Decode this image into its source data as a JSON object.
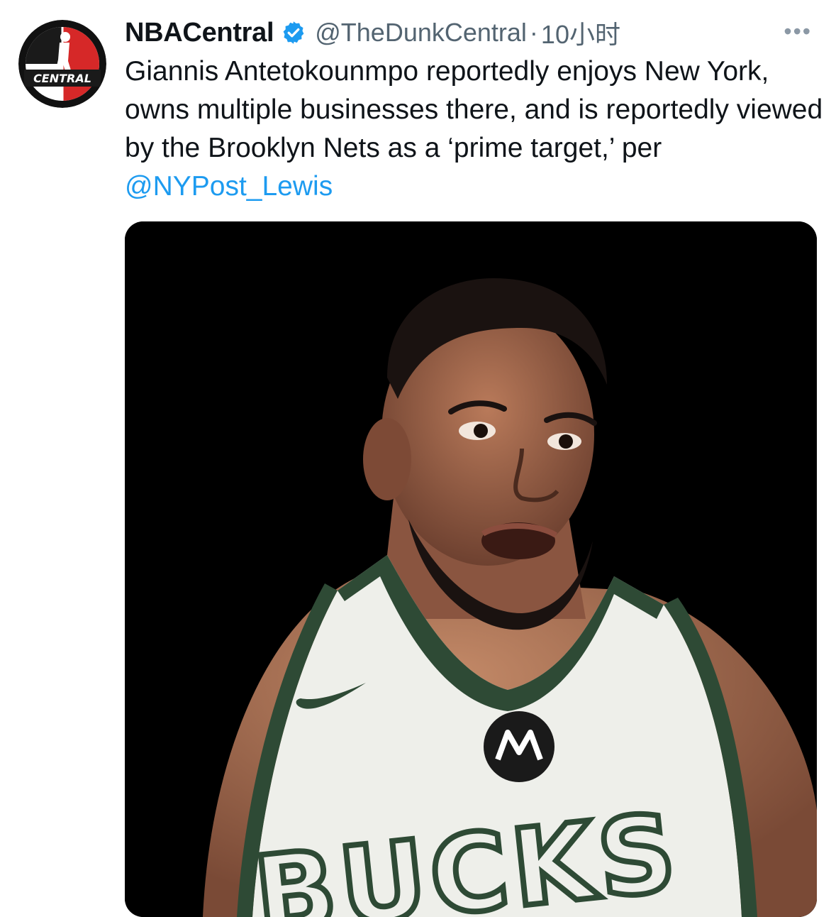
{
  "tweet": {
    "author": {
      "display_name": "NBACentral",
      "handle": "@TheDunkCentral",
      "avatar_icon": "nbacentral-logo",
      "avatar_text": "CENTRAL",
      "verified": true
    },
    "separator": "·",
    "time": "10小时",
    "more_label": "•••",
    "text_before_mention": "Giannis Antetokounmpo reportedly enjoys New York, owns multiple businesses there, and is reportedly viewed by the Brooklyn Nets as a ‘prime target,’ per ",
    "mention": "@NYPost_Lewis",
    "media": {
      "type": "photo",
      "jersey_text": "BUCKS",
      "background": "#000000"
    }
  },
  "colors": {
    "link": "#1d9bf0",
    "secondary_text": "#536471",
    "verified_badge": "#1d9bf0",
    "jersey_green": "#2e4a35"
  }
}
